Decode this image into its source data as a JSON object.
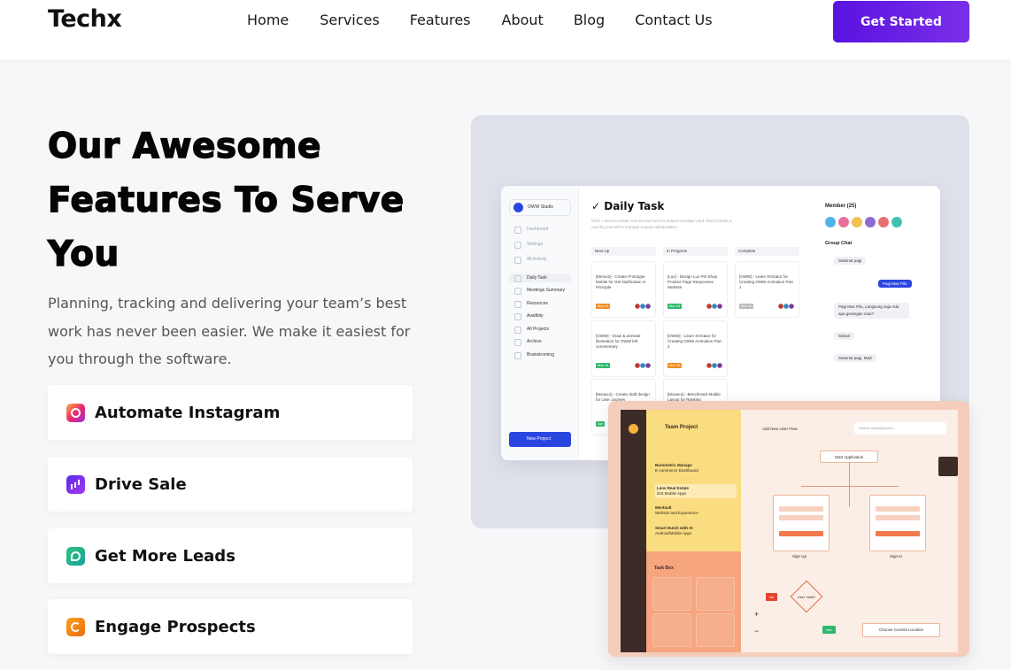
{
  "header": {
    "brand": "Techx",
    "nav": [
      "Home",
      "Services",
      "Features",
      "About",
      "Blog",
      "Contact Us"
    ],
    "cta": "Get Started"
  },
  "hero": {
    "title_lines": [
      "Our Awesome",
      "Features To Serve",
      "You"
    ],
    "description": "Planning, tracking and delivering your team’s best work has never been easier. We make it easiest for you through the software."
  },
  "features": [
    {
      "label": "Automate Instagram",
      "icon": "instagram-icon",
      "color": "#ec2a6f"
    },
    {
      "label": "Drive Sale",
      "icon": "chart-icon",
      "color": "#5b2be6"
    },
    {
      "label": "Get More Leads",
      "icon": "leads-icon",
      "color": "#2fc07d"
    },
    {
      "label": "Engage Prospects",
      "icon": "refresh-icon",
      "color": "#f7a21b"
    }
  ],
  "mock": {
    "workspace": "OWW Studio",
    "sidebar": [
      "Dashboard",
      "Settings",
      "All Activity",
      "Daily Task",
      "Meetings Summary",
      "Resources",
      "Availbity",
      "All Projects",
      "Archive",
      "Brainstroming"
    ],
    "new_project": "New Project",
    "title": "Daily Task",
    "subtitle": "Click + New to create new list and wait for project manager card. Don't Create a card by yourself to manage a good collaboration.",
    "columns": [
      "Next Up",
      "In Progress",
      "Complete"
    ],
    "cards": [
      "[Memo2] - Create Prototype Mobile for Get Notification in Principle",
      "[Lux] - Design Lux Pet Shop Product Page Responsive Website",
      "[OWW] - Learn SVGator for Creating OWW Animation Part 1",
      "[OWW] - Draw & animate illustration for OWW left commentary",
      "[OWW] - Learn SVGator for Creating OWW Animation Part 2",
      "[Monaco] - Create draft design for User Journey",
      "[Monaco] - Benchmark Mobile Layout for Ranking"
    ],
    "card_tags": [
      "Mar 24",
      "Mar 24",
      "Mar 30",
      "Mar 24",
      "Mar 28",
      "Apr"
    ],
    "member_title": "Member (25)",
    "group_chat": "Group Chat",
    "chat": [
      "Selamat pagi",
      "Pagi Mas Pilo",
      "Pagi Mas Pilo, Langsung saja Ada apa gerangan mas?",
      "Sebutt",
      "Selamat pagi, Mad"
    ]
  },
  "team": {
    "title": "Team Project",
    "items": [
      {
        "name": "Barometric Manage",
        "sub": "E-commerce Dashboard"
      },
      {
        "name": "Lens Real Estate",
        "sub": "iOS Mobile Apps"
      },
      {
        "name": "Menfault",
        "sub": "Website and Experience"
      },
      {
        "name": "Smart Hutch with AI",
        "sub": "Android/Mobile Apps"
      }
    ],
    "task_box": "Task Box",
    "tiles": [
      "Select Tab",
      "Rounded Point",
      "Animation",
      "Crash"
    ],
    "flow_title": "Add New User Flow",
    "search_placeholder": "Search anything here...",
    "nodes": [
      "Start Application",
      "Sign Up",
      "Sign In",
      "User Valid?",
      "Choose Current Location"
    ],
    "no_label": "No",
    "yes_label": "Yes",
    "zoom_in": "+",
    "zoom_out": "−"
  }
}
